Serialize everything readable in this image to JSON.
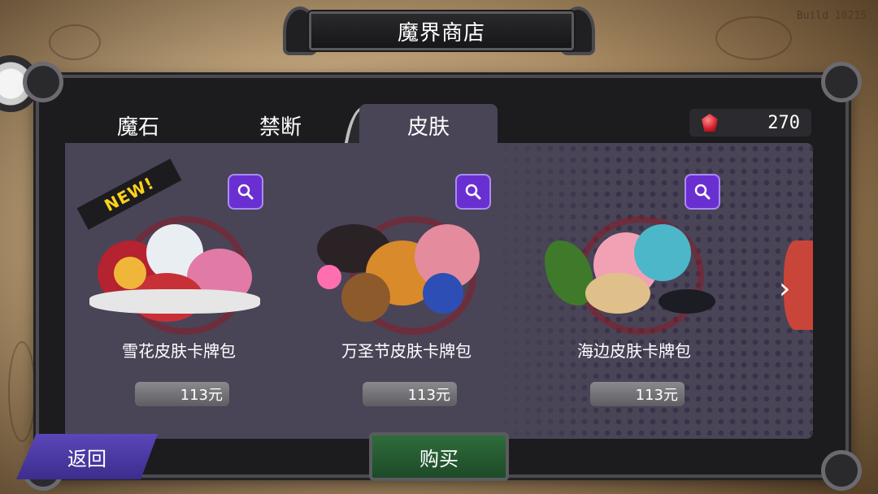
{
  "title": "魔界商店",
  "build": "Build 10215",
  "tabs": [
    {
      "label": "魔石",
      "active": false
    },
    {
      "label": "禁断",
      "active": false
    },
    {
      "label": "皮肤",
      "active": true
    }
  ],
  "currency": {
    "icon": "red-gem-icon",
    "value": "270"
  },
  "cards": [
    {
      "name": "雪花皮肤卡牌包",
      "price": "113元",
      "badge": "NEW!"
    },
    {
      "name": "万圣节皮肤卡牌包",
      "price": "113元"
    },
    {
      "name": "海边皮肤卡牌包",
      "price": "113元"
    }
  ],
  "buttons": {
    "back": "返回",
    "buy": "购买"
  },
  "colors": {
    "panel": "#4a4457",
    "zoom": "#6a2fd1",
    "buy": "#2f6c3c",
    "back": "#4a3aa8",
    "gem": "#d21f2c"
  }
}
